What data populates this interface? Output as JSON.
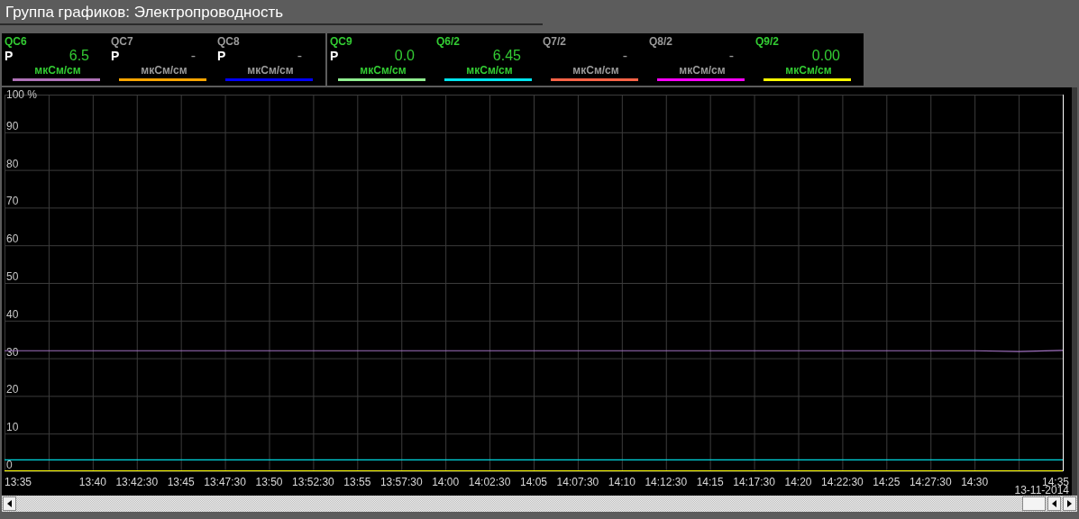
{
  "window": {
    "title": "Группа графиков: Электропроводность"
  },
  "legend_groups": [
    {
      "channels": [
        {
          "name": "QC6",
          "active": true,
          "mode": "P",
          "value": "6.5",
          "unit": "мкСм/см",
          "color": "#b072b8"
        },
        {
          "name": "QC7",
          "active": false,
          "mode": "P",
          "value": "-",
          "unit": "мкСм/см",
          "color": "#ffa500"
        },
        {
          "name": "QC8",
          "active": false,
          "mode": "P",
          "value": "-",
          "unit": "мкСм/см",
          "color": "#0000ff"
        }
      ]
    },
    {
      "channels": [
        {
          "name": "QC9",
          "active": true,
          "mode": "P",
          "value": "0.0",
          "unit": "мкСм/см",
          "color": "#90ee90"
        },
        {
          "name": "Q6/2",
          "active": true,
          "value": "6.45",
          "unit": "мкСм/см",
          "color": "#00e5ee"
        },
        {
          "name": "Q7/2",
          "active": false,
          "value": "-",
          "unit": "мкСм/см",
          "color": "#ff6347"
        },
        {
          "name": "Q8/2",
          "active": false,
          "value": "-",
          "unit": "мкСм/см",
          "color": "#ff00ff"
        },
        {
          "name": "Q9/2",
          "active": true,
          "value": "0.00",
          "unit": "мкСм/см",
          "color": "#ffff00"
        }
      ]
    }
  ],
  "chart": {
    "date": "13-11-2014",
    "chart_data": {
      "type": "line",
      "grid": true,
      "ylim": [
        0,
        100
      ],
      "categories": [
        "13:35",
        null,
        "13:40",
        "13:42:30",
        "13:45",
        "13:47:30",
        "13:50",
        "13:52:30",
        "13:55",
        "13:57:30",
        "14:00",
        "14:02:30",
        "14:05",
        "14:07:30",
        "14:10",
        "14:12:30",
        "14:15",
        "14:17:30",
        "14:20",
        "14:22:30",
        "14:25",
        "14:27:30",
        "14:30",
        null,
        "14:35"
      ],
      "yticks": [
        0,
        10,
        20,
        30,
        40,
        50,
        60,
        70,
        80,
        90,
        {
          "value": 100,
          "label": "100 %"
        }
      ],
      "series": [
        {
          "color": "#a070c0",
          "values": [
            32,
            32,
            32,
            32,
            32,
            32,
            32,
            32,
            32,
            32,
            32,
            32,
            32,
            32,
            32,
            32,
            32,
            32,
            32,
            32,
            32,
            32,
            32,
            31.8,
            32.1
          ]
        },
        {
          "color": "#00d8e0",
          "values": [
            3,
            3,
            3,
            3,
            3,
            3,
            3,
            3,
            3,
            3,
            3,
            3,
            3,
            3,
            3,
            3,
            3,
            3,
            3,
            3,
            3,
            3,
            3,
            3,
            3
          ]
        },
        {
          "color": "#ffff00",
          "values": [
            0,
            0,
            0,
            0,
            0,
            0,
            0,
            0,
            0,
            0,
            0,
            0,
            0,
            0,
            0,
            0,
            0,
            0,
            0,
            0,
            0,
            0,
            0,
            0,
            0
          ]
        }
      ]
    }
  }
}
